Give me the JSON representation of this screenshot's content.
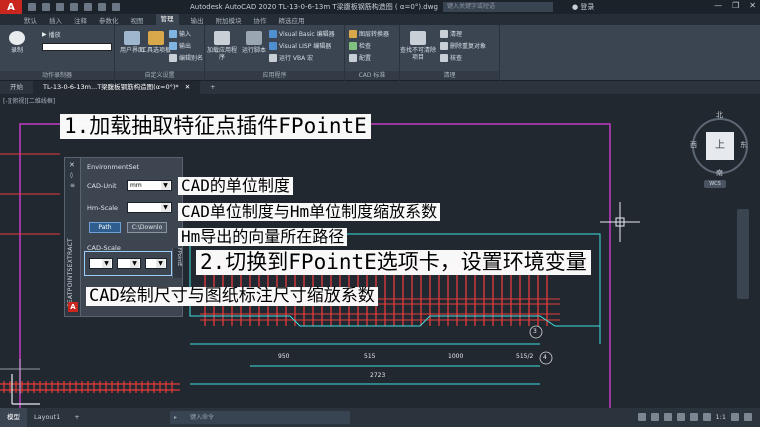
{
  "app": {
    "logo": "A",
    "title": "Autodesk AutoCAD 2020   TL-13-0-6-13m T梁腹板钢筋构造图 ( α=0°).dwg",
    "search_placeholder": "键入关键字或短语",
    "login": "登录"
  },
  "ribbon_tabs": [
    "默认",
    "插入",
    "注释",
    "参数化",
    "视图",
    "管理",
    "输出",
    "附加模块",
    "协作",
    "精选应用"
  ],
  "ribbon_active_tab": "管理",
  "ribbon": {
    "record": "录制",
    "play": "播放",
    "action_recorder": "动作录制器",
    "user_interface": "用户界面",
    "tool_palettes": "工具选项板",
    "import": "输入",
    "export": "输出",
    "edit_alias": "编辑别名",
    "customization": "自定义设置",
    "load_app": "加载应用程序",
    "run_script": "运行脚本",
    "vb_editor": "Visual Basic 编辑器",
    "lisp_editor": "Visual LISP 编辑器",
    "run_vba": "运行 VBA 宏",
    "applications": "应用程序",
    "layer_translator": "图层转换器",
    "check": "检查",
    "configure": "配置",
    "cad_standards": "CAD 标准",
    "find_nonpurgeable": "查找不可清除项目",
    "purge": "清理",
    "overkill": "删除重复对象",
    "audit": "核查",
    "cleanup": "清理"
  },
  "doc_tabs": [
    "开始",
    "TL-13-0-6-13m...T梁腹板钢筋构造图(α=0°)*"
  ],
  "viewport_label": "[-][俯视][二维线框]",
  "palette": {
    "section": "EnvironmentSet",
    "cad_unit_label": "CAD-Unit",
    "cad_unit_value": "mm",
    "hm_scale_label": "Hm-Scale",
    "path_button": "Path",
    "dir_button": "C:\\Downlo",
    "cad_scale_label": "CAD-Scale",
    "vertical_title": "FEATPOINTSEXTRACT",
    "side_tab": "FPointE"
  },
  "captions": {
    "step1": "1.加载抽取特征点插件FPointE",
    "cad_unit": "CAD的单位制度",
    "hm_scale": "CAD单位制度与Hm单位制度缩放系数",
    "path": "Hm导出的向量所在路径",
    "step2": "2.切换到FPointE选项卡，设置环境变量",
    "cad_scale": "CAD绘制尺寸与图纸标注尺寸缩放系数"
  },
  "viewcube": {
    "top": "上",
    "north": "北",
    "south": "南",
    "east": "东",
    "west": "西",
    "wcs": "WCS"
  },
  "drawing": {
    "dim_950": "950",
    "dim_515": "515",
    "dim_1000": "1000",
    "dim_5152": "515/2",
    "dim_2723": "2723",
    "mark_3": "3",
    "mark_4": "4"
  },
  "statusbar": {
    "tabs": [
      "模型",
      "Layout1"
    ],
    "command_placeholder": "键入命令",
    "scale": "1:1"
  },
  "colors": {
    "background": "#212830",
    "rebar": "#e53b3b",
    "dimension": "#3fe0e0",
    "border": "#c23cc2",
    "ribbon": "#3b4552"
  }
}
